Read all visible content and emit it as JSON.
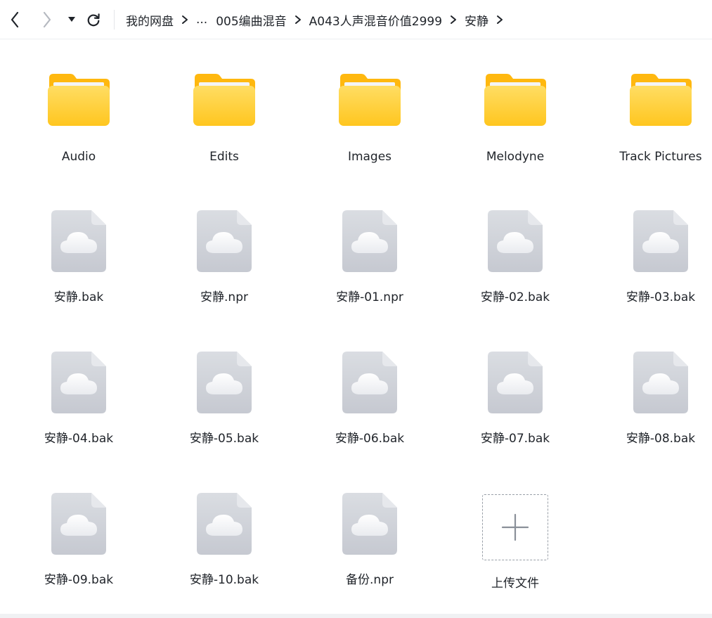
{
  "breadcrumb": {
    "items": [
      "我的网盘",
      "...",
      "005编曲混音",
      "A043人声混音价值2999",
      "安静"
    ]
  },
  "folders": [
    {
      "name": "Audio"
    },
    {
      "name": "Edits"
    },
    {
      "name": "Images"
    },
    {
      "name": "Melodyne"
    },
    {
      "name": "Track Pictures"
    }
  ],
  "files": [
    {
      "name": "安静.bak"
    },
    {
      "name": "安静.npr"
    },
    {
      "name": "安静-01.npr"
    },
    {
      "name": "安静-02.bak"
    },
    {
      "name": "安静-03.bak"
    },
    {
      "name": "安静-04.bak"
    },
    {
      "name": "安静-05.bak"
    },
    {
      "name": "安静-06.bak"
    },
    {
      "name": "安静-07.bak"
    },
    {
      "name": "安静-08.bak"
    },
    {
      "name": "安静-09.bak"
    },
    {
      "name": "安静-10.bak"
    },
    {
      "name": "备份.npr"
    }
  ],
  "upload": {
    "label": "上传文件"
  },
  "colors": {
    "folder_front_top": "#ffd95a",
    "folder_front_bottom": "#ffc21c",
    "folder_back": "#ffb80f",
    "file_body_top": "#d8dbe0",
    "file_body_bottom": "#c6c9d1",
    "upload_border": "#9aa0a8"
  },
  "icons": {
    "back": "chevron-left-icon",
    "forward": "chevron-right-icon",
    "dropdown": "caret-down-icon",
    "refresh": "refresh-icon",
    "folder": "folder-icon",
    "file": "cloud-file-icon",
    "upload": "plus-icon"
  }
}
